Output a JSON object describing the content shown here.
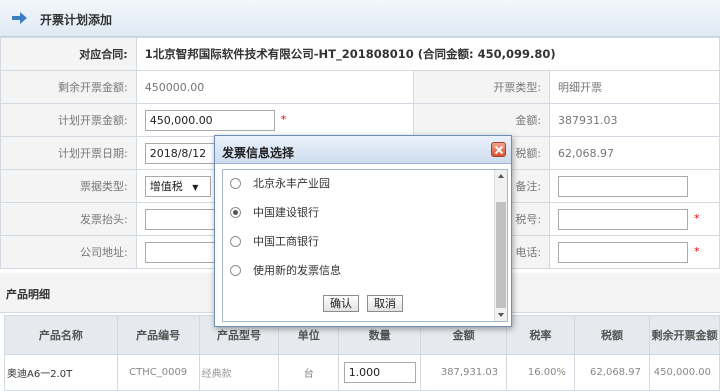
{
  "page": {
    "title": "开票计划添加"
  },
  "form": {
    "contract_label": "对应合同:",
    "contract_value": "1北京智邦国际软件技术有限公司-HT_201808010  (合同金额: 450,099.80)",
    "remaining_label": "剩余开票金额:",
    "remaining_value": "450000.00",
    "invoice_type_label": "开票类型:",
    "invoice_type_value": "明细开票",
    "planned_amount_label": "计划开票金额:",
    "planned_amount_value": "450,000.00",
    "amount_label": "金额:",
    "amount_value": "387931.03",
    "planned_date_label": "计划开票日期:",
    "planned_date_value": "2018/8/12",
    "tax_label": "税额:",
    "tax_value": "62,068.97",
    "ticket_type_label": "票据类型:",
    "ticket_type_value": "增值税",
    "remark_label": "备注:",
    "invoice_header_label": "发票抬头:",
    "tax_no_label": "税号:",
    "address_label": "公司地址:",
    "phone_label": "电话:",
    "required_mark": "*"
  },
  "products": {
    "section_title": "产品明细",
    "columns": [
      "产品名称",
      "产品编号",
      "产品型号",
      "单位",
      "数量",
      "金额",
      "税率",
      "税额",
      "剩余开票金额"
    ],
    "rows": [
      {
        "name": "奥迪A6一2.0T",
        "code": "CTHC_0009",
        "model": "经典款",
        "unit": "台",
        "qty": "1.000",
        "amount": "387,931.03",
        "rate": "16.00%",
        "tax": "62,068.97",
        "remaining": "450,000.00"
      }
    ]
  },
  "dialog": {
    "title": "发票信息选择",
    "options": [
      {
        "label": "北京永丰产业园",
        "selected": false
      },
      {
        "label": "中国建设银行",
        "selected": true
      },
      {
        "label": "中国工商银行",
        "selected": false
      },
      {
        "label": "使用新的发票信息",
        "selected": false
      }
    ],
    "confirm_label": "确认",
    "cancel_label": "取消"
  },
  "colors": {
    "accent": "#3d7fc4",
    "required": "#ee0000",
    "dialog_border": "#6e8fb4"
  }
}
